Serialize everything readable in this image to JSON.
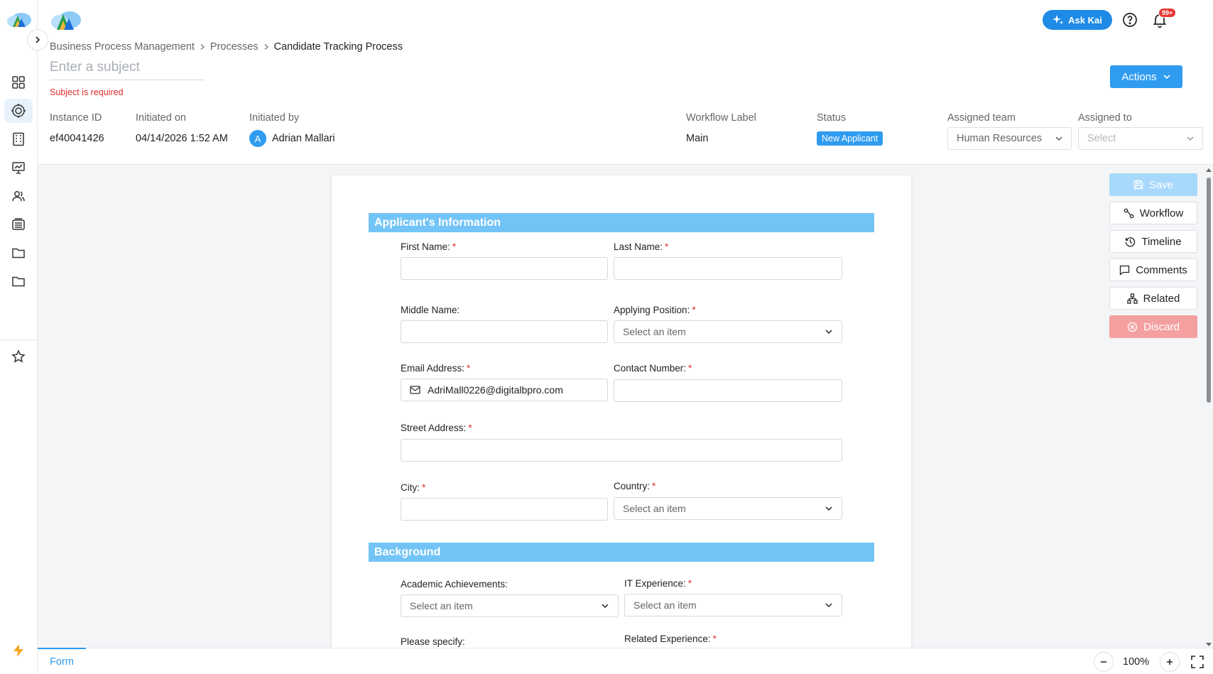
{
  "header": {
    "ask_label": "Ask Kai",
    "notif_badge": "99+",
    "user_initial": "A"
  },
  "breadcrumb": [
    "Business Process Management",
    "Processes",
    "Candidate Tracking Process"
  ],
  "subject": {
    "placeholder": "Enter a subject",
    "error": "Subject is required"
  },
  "actions_label": "Actions",
  "meta": {
    "instance_id_label": "Instance ID",
    "instance_id": "ef40041426",
    "initiated_on_label": "Initiated on",
    "initiated_on": "04/14/2026 1:52 AM",
    "initiated_by_label": "Initiated by",
    "initiated_by_initial": "A",
    "initiated_by": "Adrian Mallari",
    "workflow_label_label": "Workflow Label",
    "workflow_label": "Main",
    "status_label": "Status",
    "status": "New Applicant",
    "assigned_team_label": "Assigned team",
    "assigned_team": "Human Resources",
    "assigned_to_label": "Assigned to",
    "assigned_to": "Select"
  },
  "side_buttons": {
    "save": "Save",
    "workflow": "Workflow",
    "timeline": "Timeline",
    "comments": "Comments",
    "related": "Related",
    "discard": "Discard"
  },
  "form": {
    "section1": "Applicant's Information",
    "first_name": "First Name:",
    "last_name": "Last Name:",
    "middle_name": "Middle Name:",
    "applying_position": "Applying Position:",
    "email": "Email Address:",
    "email_value": "AdriMall0226@digitalbpro.com",
    "contact": "Contact Number:",
    "street": "Street Address:",
    "city": "City:",
    "country": "Country:",
    "select_placeholder": "Select an item",
    "section2": "Background",
    "academic": "Academic Achievements:",
    "it_experience": "IT Experience:",
    "please_specify": "Please specify:",
    "related_experience": "Related Experience:"
  },
  "bottom": {
    "tab": "Form",
    "zoom": "100%"
  },
  "colors": {
    "accent": "#2f9cf0",
    "section": "#72c4f7",
    "error": "#e02d2d",
    "discard": "#f4a0a0"
  }
}
